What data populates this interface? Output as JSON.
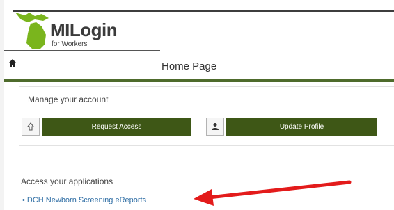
{
  "header": {
    "logo_title": "MILogin",
    "logo_subtitle": "for Workers",
    "logo_color": "#7ab51d"
  },
  "nav": {
    "home_icon": "home-icon",
    "page_title": "Home Page",
    "accent_color": "#4e6b2c"
  },
  "account": {
    "title": "Manage your account",
    "request_access_icon": "pointer-hand-icon",
    "request_access_label": "Request Access",
    "update_profile_icon": "person-icon",
    "update_profile_label": "Update Profile",
    "button_color": "#3e5716"
  },
  "applications": {
    "title": "Access your applications",
    "items": [
      {
        "label": "DCH Newborn Screening eReports"
      }
    ]
  },
  "annotation": {
    "arrow_color": "#e31b1b"
  }
}
